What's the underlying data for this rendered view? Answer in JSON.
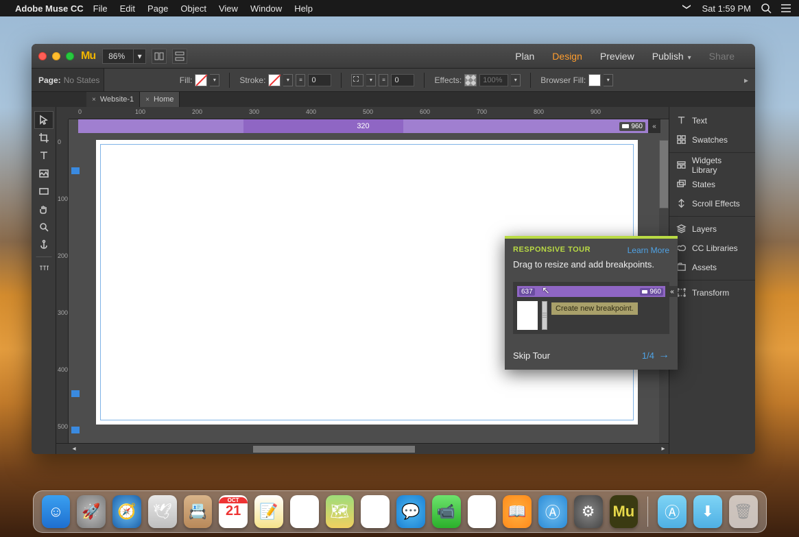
{
  "menubar": {
    "app_name": "Adobe Muse CC",
    "items": [
      "File",
      "Edit",
      "Page",
      "Object",
      "View",
      "Window",
      "Help"
    ],
    "clock": "Sat 1:59 PM"
  },
  "titlebar": {
    "zoom": "86%",
    "nav": [
      "Plan",
      "Design",
      "Preview",
      "Publish",
      "Share"
    ],
    "nav_active": "Design",
    "nav_dim": "Share"
  },
  "controlbar": {
    "page_label": "Page:",
    "page_value": "No States",
    "fill_label": "Fill:",
    "stroke_label": "Stroke:",
    "stroke_weight": "0",
    "corner_radius": "0",
    "effects_label": "Effects:",
    "opacity": "100%",
    "browser_fill_label": "Browser Fill:"
  },
  "doctabs": [
    {
      "label": "Website-1",
      "active": false
    },
    {
      "label": "Home",
      "active": true
    }
  ],
  "tools": [
    "selection",
    "hand",
    "text",
    "crop",
    "rectangle",
    "hand2",
    "zoom",
    "anchor",
    "textformat"
  ],
  "ruler_h": [
    "0",
    "100",
    "200",
    "300",
    "400",
    "500",
    "600",
    "700",
    "800",
    "900"
  ],
  "ruler_v": [
    "0",
    "100",
    "200",
    "300",
    "400",
    "500"
  ],
  "breakpoint_bar": {
    "center": "320",
    "right": "960"
  },
  "right_panel": {
    "groups": [
      [
        "Text",
        "Swatches"
      ],
      [
        "Widgets Library",
        "States",
        "Scroll Effects"
      ],
      [
        "Layers",
        "CC Libraries",
        "Assets"
      ],
      [
        "Transform"
      ]
    ]
  },
  "tour": {
    "title": "RESPONSIVE TOUR",
    "learn_more": "Learn More",
    "body": "Drag to resize and add breakpoints.",
    "demo": {
      "v1": "637",
      "v2": "960",
      "tooltip": "Create new breakpoint."
    },
    "skip": "Skip Tour",
    "step": "1/4"
  },
  "dock": {
    "apps": [
      {
        "name": "finder",
        "bg": "linear-gradient(#3aa0f0,#1e6fd0)",
        "glyph": "☺"
      },
      {
        "name": "launchpad",
        "bg": "radial-gradient(#c0c0c0,#7a7a7a)",
        "glyph": "🚀"
      },
      {
        "name": "safari",
        "bg": "radial-gradient(#6ec1f5,#1a5fa8)",
        "glyph": "🧭"
      },
      {
        "name": "mail",
        "bg": "linear-gradient(#e8e8e8,#bfbfbf)",
        "glyph": "🕊"
      },
      {
        "name": "contacts",
        "bg": "linear-gradient(#d8b48a,#b8895a)",
        "glyph": "📇"
      },
      {
        "name": "calendar",
        "bg": "#fff",
        "glyph": "21"
      },
      {
        "name": "notes",
        "bg": "linear-gradient(#fff,#f6e38a)",
        "glyph": "📝"
      },
      {
        "name": "reminders",
        "bg": "#fff",
        "glyph": "☑"
      },
      {
        "name": "maps",
        "bg": "linear-gradient(#9edc7a,#f0d060)",
        "glyph": "🗺"
      },
      {
        "name": "photos",
        "bg": "#fff",
        "glyph": "✿"
      },
      {
        "name": "messages",
        "bg": "radial-gradient(#4fb9f0,#1a80d4)",
        "glyph": "💬"
      },
      {
        "name": "facetime",
        "bg": "linear-gradient(#6de36d,#2bb02b)",
        "glyph": "📹"
      },
      {
        "name": "itunes",
        "bg": "#fff",
        "glyph": "♪"
      },
      {
        "name": "ibooks",
        "bg": "radial-gradient(#ffb040,#ff8a1a)",
        "glyph": "📖"
      },
      {
        "name": "appstore",
        "bg": "radial-gradient(#6fbef0,#2a8ad6)",
        "glyph": "Ⓐ"
      },
      {
        "name": "preferences",
        "bg": "radial-gradient(#888,#444)",
        "glyph": "⚙"
      },
      {
        "name": "muse",
        "bg": "#3a3a12",
        "glyph": "Mu"
      }
    ],
    "right_apps": [
      {
        "name": "apps-folder",
        "bg": "linear-gradient(#7fd4f5,#4fb0e4)",
        "glyph": "Ⓐ"
      },
      {
        "name": "downloads-folder",
        "bg": "linear-gradient(#7fd4f5,#4fb0e4)",
        "glyph": "⬇"
      },
      {
        "name": "trash",
        "bg": "rgba(255,255,255,.6)",
        "glyph": "🗑"
      }
    ]
  }
}
